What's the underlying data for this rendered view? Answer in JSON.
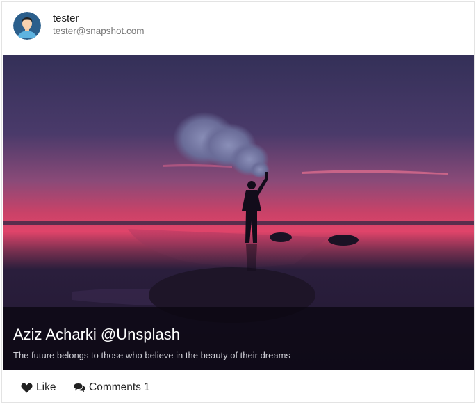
{
  "user": {
    "name": "tester",
    "email": "tester@snapshot.com",
    "avatar_icon": "user-avatar-icon"
  },
  "post": {
    "caption_title": "Aziz Acharki @Unsplash",
    "caption_text": "The future belongs to those who believe in the beauty of their dreams"
  },
  "actions": {
    "like_label": "Like",
    "like_icon": "heart-icon",
    "comments_label": "Comments",
    "comments_count": "1",
    "comments_icon": "comments-icon"
  },
  "colors": {
    "sky_top": "#3b3562",
    "horizon": "#e0446a",
    "ground": "#241a36"
  }
}
